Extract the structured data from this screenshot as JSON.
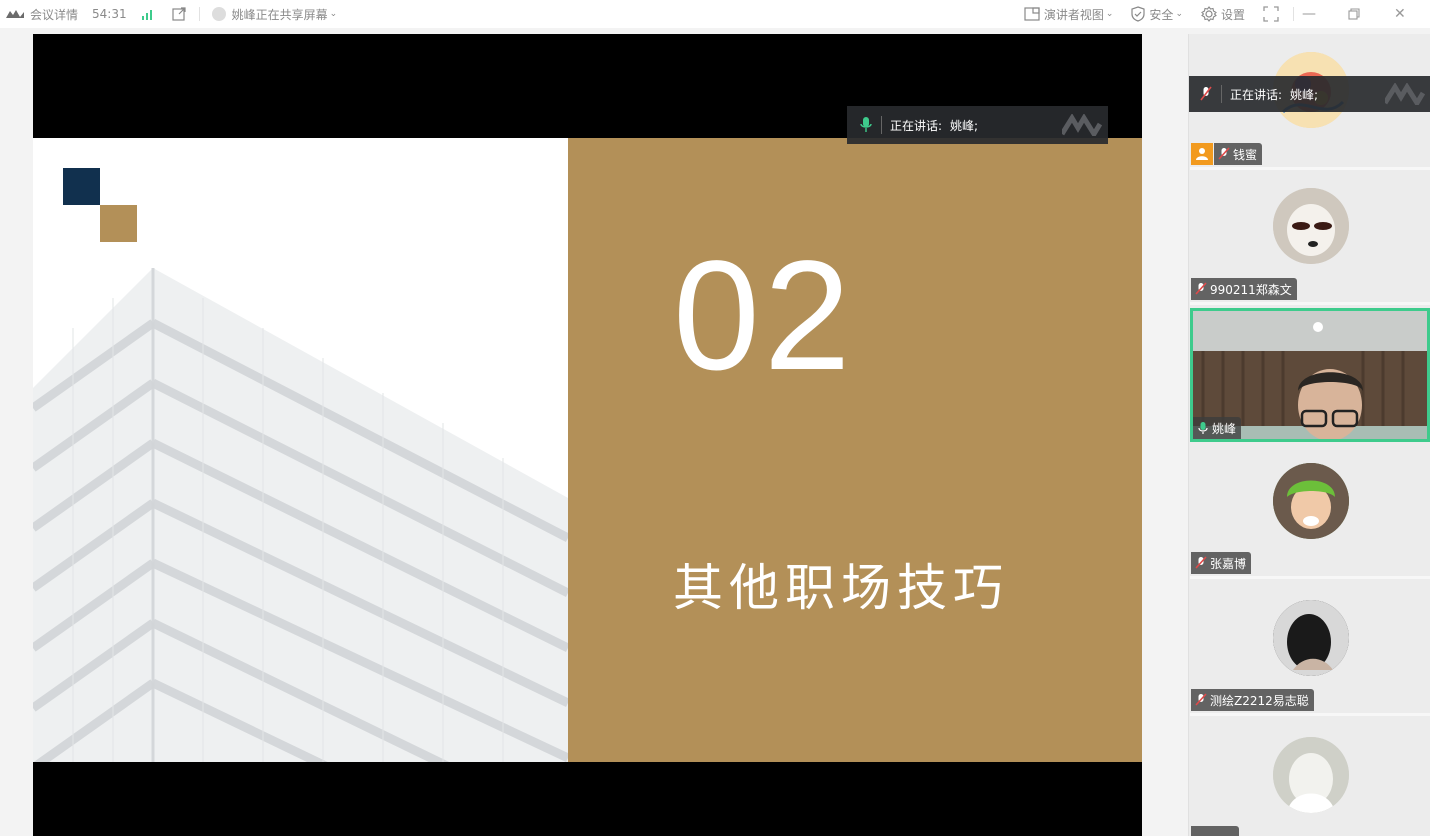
{
  "topbar": {
    "meeting_info": "会议详情",
    "timer": "54:31",
    "sharing_status": "姚峰正在共享屏幕",
    "presenter_view": "演讲者视图",
    "security": "安全",
    "settings": "设置"
  },
  "slide": {
    "number": "02",
    "title": "其他职场技巧"
  },
  "speaking": {
    "label": "正在讲话:",
    "speaker": "姚峰;"
  },
  "participants": [
    {
      "name": "钱蜜",
      "muted": true
    },
    {
      "name": "990211郑森文",
      "muted": true
    },
    {
      "name": "姚峰",
      "muted": false,
      "video": true,
      "active": true
    },
    {
      "name": "张嘉博",
      "muted": true
    },
    {
      "name": "测绘Z2212易志聪",
      "muted": true
    }
  ],
  "colors": {
    "slide_gold": "#b39058",
    "slide_navy": "#11304e",
    "active_border": "#3ecb8c",
    "host_badge": "#f29a1e"
  }
}
